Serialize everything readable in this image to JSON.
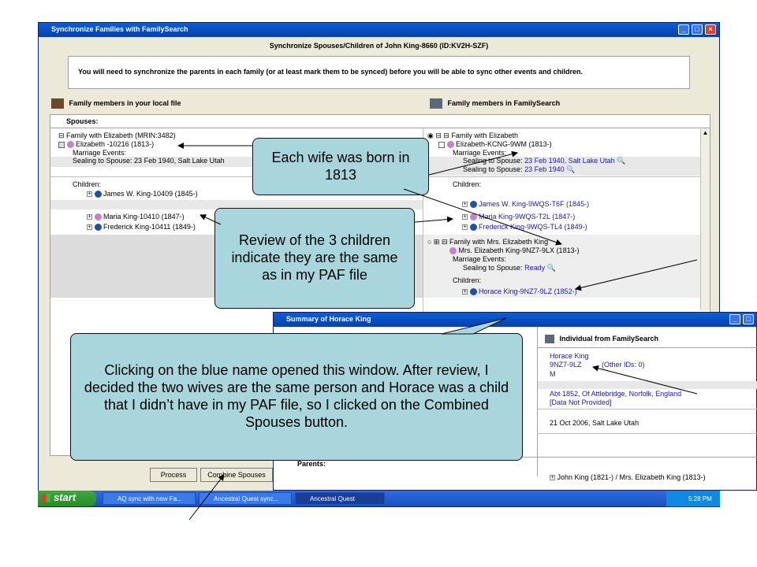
{
  "main_window": {
    "title": "Synchronize Families with FamilySearch",
    "heading": "Synchronize Spouses/Children of John King-8660  (ID:KV2H-SZF)",
    "notice": "You will need to synchronize the parents in each family (or at least mark them to be synced) before you will be able to sync other events and children.",
    "left_header": "Family members in your local file",
    "right_header": "Family members in FamilySearch",
    "spouses_label": "Spouses:",
    "left": {
      "family1": "Family with Elizabeth (MRIN:3482)",
      "spouse1": "Elizabeth -10216 (1813-)",
      "marriage_events": "Marriage Events:",
      "sealing": "Sealing to Spouse: 23 Feb 1940, Salt Lake Utah",
      "children_label": "Children:",
      "children": [
        "James W. King-10409 (1845-)",
        "Maria King-10410 (1847-)",
        "Frederick King-10411 (1849-)"
      ]
    },
    "right": {
      "family1": "Family with Elizabeth",
      "spouse1": "Elizabeth-KCNG-9WM (1813-)",
      "marriage_events": "Marriage Events:",
      "sealing1_prefix": "Sealing to Spouse:",
      "sealing1_value": "23 Feb 1940, Salt Lake Utah",
      "sealing2_prefix": "Sealing to Spouse:",
      "sealing2_value": "23 Feb 1940",
      "children_label": "Children:",
      "children": [
        "James W. King-9WQS-T6F (1845-)",
        "Maria King-9WQS-T2L (1847-)",
        "Frederick King-9WQS-TL4 (1849-)"
      ],
      "family2": "Family with Mrs. Elizabeth King",
      "spouse2": "Mrs. Elizabeth King-9NZ7-9LX (1813-)",
      "marriage_events2": "Marriage Events:",
      "sealing3_prefix": "Sealing to Spouse:",
      "sealing3_value": "Ready",
      "children_label2": "Children:",
      "child_horace": "Horace King-9NZ7-9LZ (1852-)"
    },
    "buttons": {
      "process": "Process",
      "combine": "Combine Spouses"
    }
  },
  "summary_window": {
    "title": "Summary of Horace King",
    "col_header": "Individual from FamilySearch",
    "name": "Horace King",
    "id": "9NZ7-9LZ",
    "other_ids": "(Other IDs: 0)",
    "sex": "M",
    "birth": "Abt 1852, Of Attlebridge, Norfolk, England",
    "data_not_provided": "[Data Not Provided]",
    "ordinance": "21 Oct 2006, Salt Lake Utah",
    "parents_label": "Parents:",
    "parents_value": "John King (1821-) / Mrs. Elizabeth King (1813-)"
  },
  "callouts": {
    "wife": "Each wife was born in 1813",
    "children": "Review of the 3 children indicate they are the same as in my PAF file",
    "clicking": "Clicking on the blue name opened this window. After review, I decided the two wives are the same person and Horace was a child that I didn’t have in my PAF file, so I clicked on the Combined Spouses button."
  },
  "taskbar": {
    "start": "start",
    "tasks": [
      "AQ sync with new Fa...",
      "Ancestral Quest sync...",
      "Ancestral Quest"
    ],
    "clock": "5:28 PM"
  },
  "icons": [
    "family-tree-icon",
    "person-male-icon",
    "person-female-icon",
    "magnifier-icon",
    "expand-icon",
    "windows-flag-icon"
  ],
  "colors": {
    "callout_fill": "#a9d6dc",
    "link_blue": "#1a1aa6",
    "titlebar_blue": "#0a5fd8",
    "start_green": "#3da83d"
  }
}
